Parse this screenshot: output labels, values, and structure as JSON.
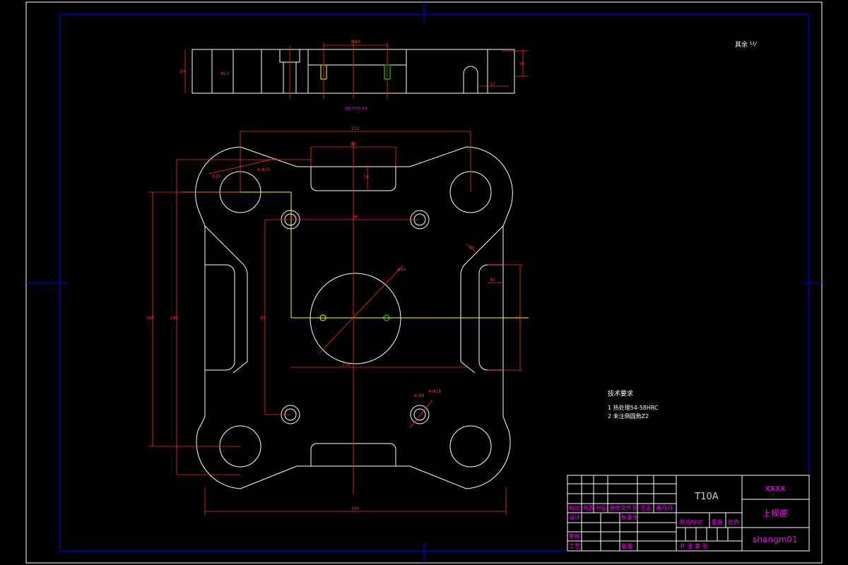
{
  "section": {
    "label": "SECTION A-A",
    "dim_width": "Φ60",
    "dim_height_left": "20",
    "dim_height_right": "10",
    "dim_slot": "17",
    "dim_note": "Φ13"
  },
  "plan": {
    "dim_top_width": "215",
    "dim_slot_width": "80",
    "dim_slot_depth": "14",
    "dim_hole_radius": "R20",
    "dim_hole_diam": "4-Φ25",
    "dim_center": "66",
    "dim_left_outer": "160",
    "dim_left_inner": "140",
    "dim_left_mid": "95",
    "dim_center_diam": "Φ90",
    "dim_bottom_inner": "215",
    "dim_bottom_total": "160",
    "dim_right_side": "60",
    "dim_right_slot": "40",
    "dim_chamfer": "3x",
    "dim_small_hole": "4-Φ8",
    "dim_small_hole2": "4-Φ18"
  },
  "corner_note": "其余 ¹²⁄",
  "tech": {
    "title": "技术要求",
    "items": [
      "1  热处理54-58HRC",
      "2  未注倒圆角Z2"
    ]
  },
  "title_block": {
    "material": "T10A",
    "company": "xxxx",
    "part_name": "上模座",
    "drawing_no": "shangm01",
    "row_labels": [
      "标记",
      "处数",
      "分区",
      "更改文件号",
      "签名",
      "年月日"
    ],
    "left_labels": [
      "设计",
      "审核",
      "工艺"
    ],
    "mid_labels": [
      "标准化",
      "批准"
    ],
    "stage_labels": [
      "阶段标记",
      "重量",
      "比例"
    ],
    "sheet_label": "共  张  第  张"
  },
  "colors": {
    "border": "#0000ff",
    "outline": "#ffffff",
    "dimension": "#ff2a2a",
    "centerline": "#ffff00",
    "label": "#ff00ff"
  }
}
